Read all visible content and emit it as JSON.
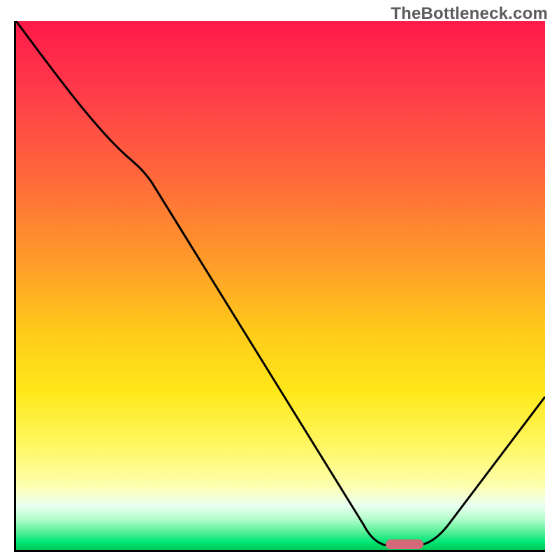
{
  "watermark": "TheBottleneck.com",
  "chart_data": {
    "type": "line",
    "title": "",
    "xlabel": "",
    "ylabel": "",
    "xlim": [
      0,
      100
    ],
    "ylim": [
      0,
      100
    ],
    "x": [
      0,
      20,
      22,
      66,
      72,
      76,
      82,
      100
    ],
    "values": [
      100,
      75,
      72,
      4,
      0,
      0,
      4,
      28
    ],
    "marker": {
      "x_center": 74,
      "y": 0,
      "width_pct": 7,
      "color": "#d4697a"
    },
    "gradient_stops": [
      {
        "pct": 0,
        "color": "#ff1a4a"
      },
      {
        "pct": 13,
        "color": "#ff3a4a"
      },
      {
        "pct": 30,
        "color": "#ff6a3a"
      },
      {
        "pct": 45,
        "color": "#ff9a2a"
      },
      {
        "pct": 58,
        "color": "#ffc81a"
      },
      {
        "pct": 70,
        "color": "#ffe81a"
      },
      {
        "pct": 80,
        "color": "#fff760"
      },
      {
        "pct": 88,
        "color": "#fdffb0"
      },
      {
        "pct": 91.5,
        "color": "#eafff0"
      },
      {
        "pct": 94,
        "color": "#b8ffcf"
      },
      {
        "pct": 96.5,
        "color": "#5cf098"
      },
      {
        "pct": 98.5,
        "color": "#00e676"
      },
      {
        "pct": 100,
        "color": "#00c853"
      }
    ]
  }
}
